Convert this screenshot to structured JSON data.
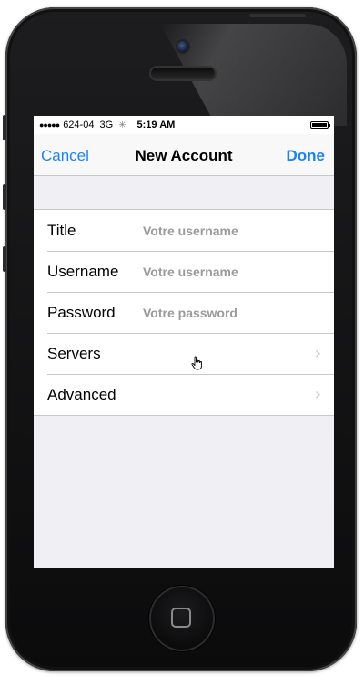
{
  "status": {
    "signal": "●●●●●",
    "carrier": "624-04",
    "network": "3G",
    "time": "5:19 AM"
  },
  "nav": {
    "cancel": "Cancel",
    "title": "New Account",
    "done": "Done"
  },
  "form": {
    "rows": [
      {
        "label": "Title",
        "placeholder": "Votre username"
      },
      {
        "label": "Username",
        "placeholder": "Votre username"
      },
      {
        "label": "Password",
        "placeholder": "Votre password"
      },
      {
        "label": "Servers"
      },
      {
        "label": "Advanced"
      }
    ]
  },
  "colors": {
    "tint": "#1a82fb",
    "background": "#efeff4"
  },
  "icons": [
    "chevron-right-icon",
    "hand-cursor-icon",
    "battery-icon",
    "spinner-icon"
  ]
}
